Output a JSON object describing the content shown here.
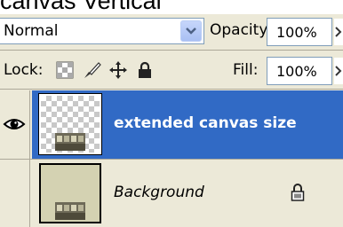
{
  "caption": "canvas Vertical",
  "blend_mode": {
    "value": "Normal",
    "options": [
      "Normal"
    ]
  },
  "opacity": {
    "label": "Opacity:",
    "value": "100%"
  },
  "lock": {
    "label": "Lock:",
    "icons": [
      "lock-transparent-pixels-icon",
      "lock-image-pixels-icon",
      "lock-position-icon",
      "lock-all-icon"
    ]
  },
  "fill": {
    "label": "Fill:",
    "value": "100%"
  },
  "layers": [
    {
      "name": "extended canvas size",
      "selected": true,
      "visible": true,
      "thumbnail": "transparent-with-building"
    },
    {
      "name": "Background",
      "selected": false,
      "visible": false,
      "locked": true,
      "thumbnail": "solid-with-building"
    }
  ],
  "colors": {
    "selection": "#316ac5",
    "panel": "#ece9d8",
    "field_border": "#7f9db9"
  }
}
